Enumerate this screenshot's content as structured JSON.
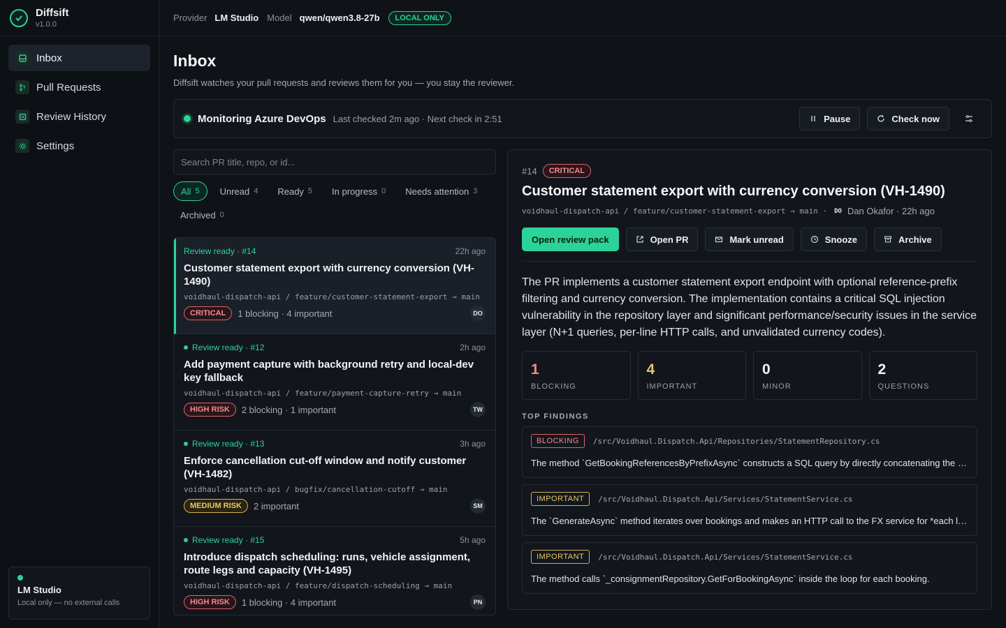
{
  "brand": {
    "name": "Diffsift",
    "version": "v1.0.0"
  },
  "nav": [
    {
      "label": "Inbox",
      "active": true,
      "icon": "inbox-icon"
    },
    {
      "label": "Pull Requests",
      "active": false,
      "icon": "pull-request-icon"
    },
    {
      "label": "Review History",
      "active": false,
      "icon": "history-icon"
    },
    {
      "label": "Settings",
      "active": false,
      "icon": "settings-icon"
    }
  ],
  "lm_card": {
    "title": "LM Studio",
    "subtitle": "Local only — no external calls"
  },
  "topbar": {
    "provider_label": "Provider",
    "provider_value": "LM Studio",
    "model_label": "Model",
    "model_value": "qwen/qwen3.8-27b",
    "badge": "LOCAL ONLY"
  },
  "page": {
    "title": "Inbox",
    "subtitle": "Diffsift watches your pull requests and reviews them for you — you stay the reviewer."
  },
  "monitor": {
    "title": "Monitoring Azure DevOps",
    "meta": "Last checked 2m ago · Next check in 2:51",
    "pause_label": "Pause",
    "check_label": "Check now"
  },
  "search": {
    "placeholder": "Search PR title, repo, or id..."
  },
  "filters": [
    {
      "label": "All",
      "count": "5",
      "active": true
    },
    {
      "label": "Unread",
      "count": "4",
      "active": false
    },
    {
      "label": "Ready",
      "count": "5",
      "active": false
    },
    {
      "label": "In progress",
      "count": "0",
      "active": false
    },
    {
      "label": "Needs attention",
      "count": "3",
      "active": false
    },
    {
      "label": "Archived",
      "count": "0",
      "active": false
    }
  ],
  "prs": [
    {
      "status": "Review ready · #14",
      "time": "22h ago",
      "title": "Customer statement export with currency conversion (VH-1490)",
      "branch": "voidhaul-dispatch-api / feature/customer-statement-export → main",
      "risk": "CRITICAL",
      "risk_level": "critical",
      "summary": "1 blocking · 4 important",
      "avatar": "DO",
      "selected": true,
      "dot": false
    },
    {
      "status": "Review ready · #12",
      "time": "2h ago",
      "title": "Add payment capture with background retry and local-dev key fallback",
      "branch": "voidhaul-dispatch-api / feature/payment-capture-retry → main",
      "risk": "HIGH RISK",
      "risk_level": "high",
      "summary": "2 blocking · 1 important",
      "avatar": "TW",
      "selected": false,
      "dot": true
    },
    {
      "status": "Review ready · #13",
      "time": "3h ago",
      "title": "Enforce cancellation cut-off window and notify customer (VH-1482)",
      "branch": "voidhaul-dispatch-api / bugfix/cancellation-cutoff → main",
      "risk": "MEDIUM RISK",
      "risk_level": "medium",
      "summary": "2 important",
      "avatar": "SM",
      "selected": false,
      "dot": true
    },
    {
      "status": "Review ready · #15",
      "time": "5h ago",
      "title": "Introduce dispatch scheduling: runs, vehicle assignment, route legs and capacity (VH-1495)",
      "branch": "voidhaul-dispatch-api / feature/dispatch-scheduling → main",
      "risk": "HIGH RISK",
      "risk_level": "high",
      "summary": "1 blocking · 4 important",
      "avatar": "PN",
      "selected": false,
      "dot": true
    }
  ],
  "detail": {
    "id": "#14",
    "risk": "CRITICAL",
    "title": "Customer statement export with currency conversion (VH-1490)",
    "branch": "voidhaul-dispatch-api / feature/customer-statement-export → main ·",
    "author_initials": "DO",
    "author": "Dan Okafor · 22h ago",
    "actions": {
      "open_review": "Open review pack",
      "open_pr": "Open PR",
      "mark_unread": "Mark unread",
      "snooze": "Snooze",
      "archive": "Archive"
    },
    "summary": "The PR implements a customer statement export endpoint with optional reference-prefix filtering and currency conversion. The implementation contains a critical SQL injection vulnerability in the repository layer and significant performance/security issues in the service layer (N+1 queries, per-line HTTP calls, and unvalidated currency codes).",
    "stats": [
      {
        "value": "1",
        "label": "BLOCKING",
        "color": "#f08b93"
      },
      {
        "value": "4",
        "label": "IMPORTANT",
        "color": "#e8c766"
      },
      {
        "value": "0",
        "label": "MINOR",
        "color": "#f1f3f5"
      },
      {
        "value": "2",
        "label": "QUESTIONS",
        "color": "#f1f3f5"
      }
    ],
    "findings_title": "TOP FINDINGS",
    "findings": [
      {
        "tag": "BLOCKING",
        "level": "blocking",
        "path": "/src/Voidhaul.Dispatch.Api/Repositories/StatementRepository.cs",
        "text": "The method `GetBookingReferencesByPrefixAsync` constructs a SQL query by directly concatenating the user-supplied prefix"
      },
      {
        "tag": "IMPORTANT",
        "level": "important",
        "path": "/src/Voidhaul.Dispatch.Api/Services/StatementService.cs",
        "text": "The `GenerateAsync` method iterates over bookings and makes an HTTP call to the FX service for *each line item"
      },
      {
        "tag": "IMPORTANT",
        "level": "important",
        "path": "/src/Voidhaul.Dispatch.Api/Services/StatementService.cs",
        "text": "The method calls `_consignmentRepository.GetForBookingAsync` inside the loop for each booking."
      }
    ]
  }
}
